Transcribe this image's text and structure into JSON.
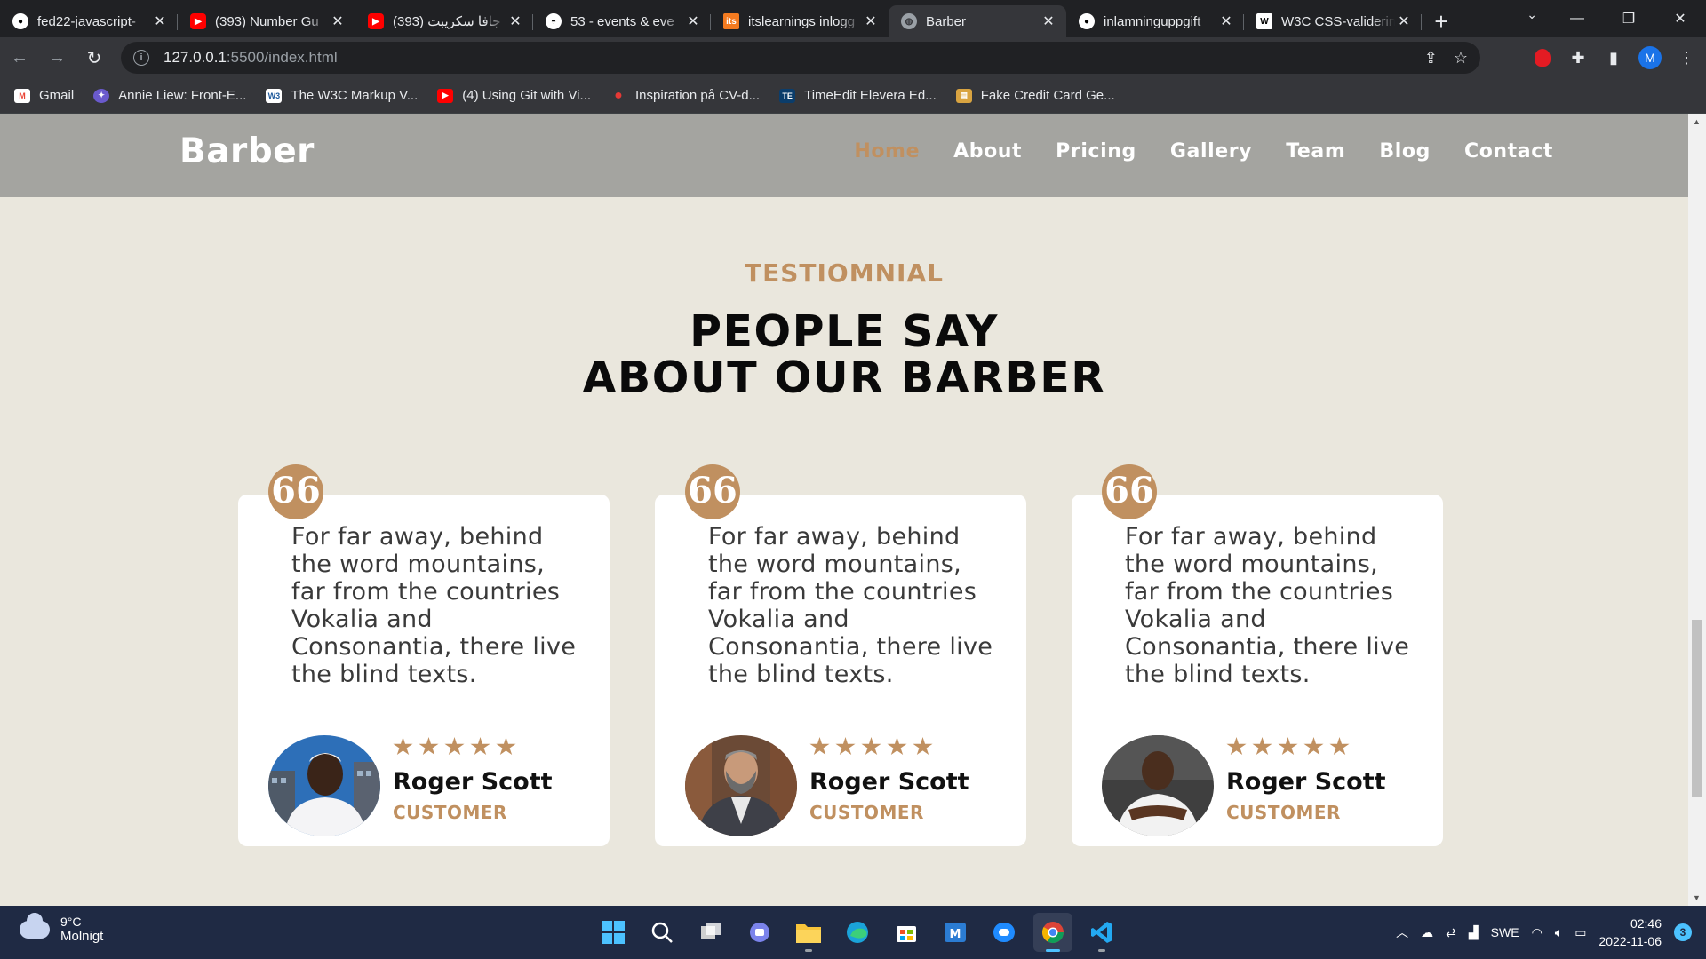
{
  "browser": {
    "tabs": [
      {
        "title": "fed22-javascript-",
        "icon": "github-icon",
        "color": "#ffffff",
        "active": false
      },
      {
        "title": "(393) Number Gu",
        "icon": "youtube-icon",
        "color": "#ff0000",
        "active": false
      },
      {
        "title": "(393) جافا سكريبت",
        "icon": "youtube-icon",
        "color": "#ff0000",
        "active": false
      },
      {
        "title": "53 - events & eve",
        "icon": "site-icon",
        "color": "#ffffff",
        "active": false
      },
      {
        "title": "itslearnings inlogg",
        "icon": "itslearning-icon",
        "color": "#f47b20",
        "active": false
      },
      {
        "title": "Barber",
        "icon": "globe-icon",
        "color": "#9aa0a6",
        "active": true
      },
      {
        "title": "inlamninguppgift",
        "icon": "github-icon",
        "color": "#ffffff",
        "active": false
      },
      {
        "title": "W3C CSS-validerin",
        "icon": "w3c-icon",
        "color": "#ffffff",
        "active": false
      }
    ],
    "url_host": "127.0.0.1",
    "url_path": ":5500/index.html",
    "profile_initial": "M",
    "bookmarks": [
      {
        "label": "Gmail",
        "icon": "gmail-icon",
        "color": "#ea4335"
      },
      {
        "label": "Annie Liew: Front-E...",
        "icon": "bookmark-site-icon",
        "color": "#6a5acd"
      },
      {
        "label": "The W3C Markup V...",
        "icon": "w3c-icon",
        "color": "#1f5a9c"
      },
      {
        "label": "(4) Using Git with Vi...",
        "icon": "youtube-icon",
        "color": "#ff0000"
      },
      {
        "label": "Inspiration på CV-d...",
        "icon": "pin-icon",
        "color": "#e53935"
      },
      {
        "label": "TimeEdit Elevera Ed...",
        "icon": "timeedit-icon",
        "color": "#0b3d6b"
      },
      {
        "label": "Fake Credit Card Ge...",
        "icon": "credit-card-icon",
        "color": "#d9a441"
      }
    ]
  },
  "site": {
    "brand": "Barber",
    "nav": [
      "Home",
      "About",
      "Pricing",
      "Gallery",
      "Team",
      "Blog",
      "Contact"
    ],
    "active_nav": "Home",
    "eyebrow": "TESTIOMNIAL",
    "heading_line1": "PEOPLE SAY",
    "heading_line2": "ABOUT OUR BARBER",
    "accent_color": "#c09060",
    "testimonials": [
      {
        "quote_mark": "66",
        "text": "For far away, behind the word mountains, far from the countries Vokalia and Consonantia, there live the blind texts.",
        "rating": 5,
        "name": "Roger Scott",
        "role": "CUSTOMER"
      },
      {
        "quote_mark": "66",
        "text": "For far away, behind the word mountains, far from the countries Vokalia and Consonantia, there live the blind texts.",
        "rating": 5,
        "name": "Roger Scott",
        "role": "CUSTOMER"
      },
      {
        "quote_mark": "66",
        "text": "For far away, behind the word mountains, far from the countries Vokalia and Consonantia, there live the blind texts.",
        "rating": 5,
        "name": "Roger Scott",
        "role": "CUSTOMER"
      }
    ]
  },
  "taskbar": {
    "temperature": "9°C",
    "weather": "Molnigt",
    "language": "SWE",
    "time": "02:46",
    "date": "2022-11-06",
    "notifications": "3",
    "apps": [
      "start-icon",
      "search-icon",
      "task-view-icon",
      "chat-icon",
      "file-explorer-icon",
      "edge-icon",
      "store-icon",
      "mail-icon",
      "messenger-icon",
      "chrome-icon",
      "vscode-icon"
    ]
  }
}
